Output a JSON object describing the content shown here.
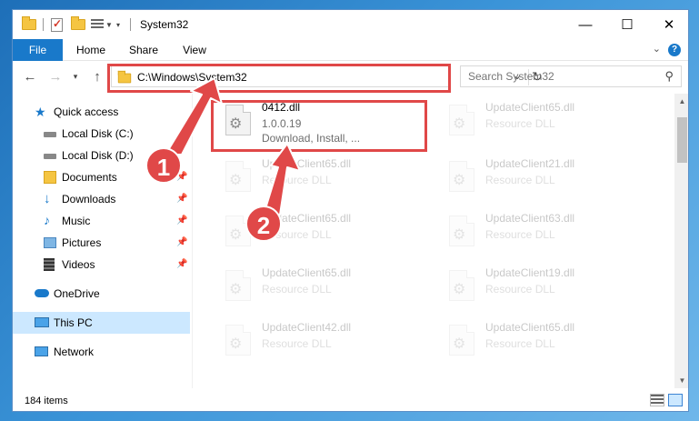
{
  "window": {
    "title": "System32",
    "controls": {
      "minimize": "—",
      "maximize": "☐",
      "close": "✕"
    }
  },
  "ribbon": {
    "tabs": [
      {
        "label": "File",
        "active": true
      },
      {
        "label": "Home"
      },
      {
        "label": "Share"
      },
      {
        "label": "View"
      }
    ]
  },
  "address": {
    "path": "C:\\Windows\\System32",
    "search_placeholder": "Search System32"
  },
  "nav": {
    "items": [
      {
        "label": "Quick access",
        "icon": "star-icon"
      },
      {
        "label": "Local Disk (C:)",
        "icon": "drive-icon"
      },
      {
        "label": "Local Disk (D:)",
        "icon": "drive-icon"
      },
      {
        "label": "Documents",
        "icon": "documents-icon",
        "pinned": true
      },
      {
        "label": "Downloads",
        "icon": "download-arrow-icon",
        "pinned": true
      },
      {
        "label": "Music",
        "icon": "music-note-icon",
        "pinned": true
      },
      {
        "label": "Pictures",
        "icon": "pictures-icon",
        "pinned": true
      },
      {
        "label": "Videos",
        "icon": "film-icon",
        "pinned": true
      },
      {
        "label": "OneDrive",
        "icon": "cloud-icon"
      },
      {
        "label": "This PC",
        "icon": "monitor-icon",
        "selected": true
      },
      {
        "label": "Network",
        "icon": "network-icon"
      }
    ]
  },
  "files": [
    {
      "name": "0412.dll",
      "line2": "1.0.0.19",
      "line3": "Download, Install, ..."
    },
    {
      "name": "UpdateClient65.dll",
      "line2": "Resource DLL"
    },
    {
      "name": "UpdateClient65.dll",
      "line2": "Resource DLL"
    },
    {
      "name": "UpdateClient21.dll",
      "line2": "Resource DLL"
    },
    {
      "name": "UpdateClient65.dll",
      "line2": "Resource DLL"
    },
    {
      "name": "UpdateClient63.dll",
      "line2": "Resource DLL"
    },
    {
      "name": "UpdateClient65.dll",
      "line2": "Resource DLL"
    },
    {
      "name": "UpdateClient19.dll",
      "line2": "Resource DLL"
    },
    {
      "name": "UpdateClient42.dll",
      "line2": "Resource DLL"
    },
    {
      "name": "UpdateClient65.dll",
      "line2": "Resource DLL"
    }
  ],
  "status": {
    "items_count": "184 items"
  },
  "annotations": {
    "step1": "1",
    "step2": "2",
    "color": "#e04848"
  }
}
